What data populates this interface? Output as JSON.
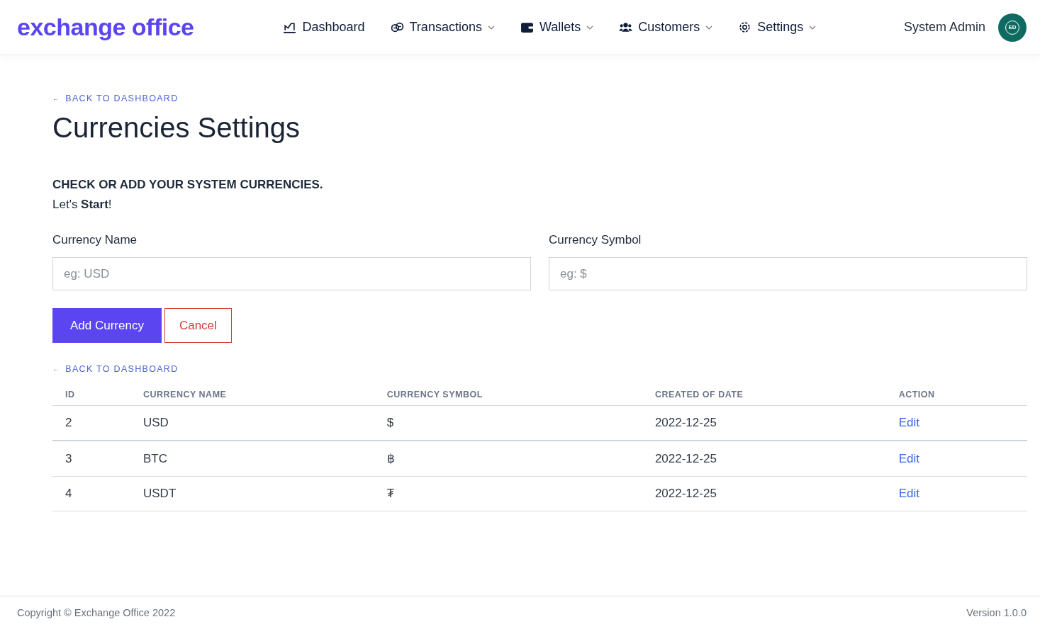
{
  "header": {
    "logo": "exchange office",
    "nav": [
      {
        "label": "Dashboard",
        "kind": "link"
      },
      {
        "label": "Transactions",
        "kind": "menu"
      },
      {
        "label": "Wallets",
        "kind": "menu"
      },
      {
        "label": "Customers",
        "kind": "menu"
      },
      {
        "label": "Settings",
        "kind": "menu"
      }
    ],
    "user": {
      "name": "System Admin",
      "initials": "ED"
    }
  },
  "page": {
    "back_link": {
      "arrow": "←",
      "label": "BACK TO DASHBOARD"
    },
    "title": "Currencies Settings",
    "subtitle": "CHECK OR ADD YOUR SYSTEM CURRENCIES.",
    "intro": "Let's **Start**!"
  },
  "form": {
    "fields": [
      {
        "label": "Currency Name",
        "placeholder": "eg: USD"
      },
      {
        "label": "Currency Symbol",
        "placeholder": "eg: $"
      }
    ],
    "buttons": [
      {
        "label": "Add Currency",
        "kind": "primary"
      },
      {
        "label": "Cancel",
        "kind": "outline"
      }
    ]
  },
  "table_back_link": {
    "arrow": "←",
    "label": "BACK TO DASHBOARD"
  },
  "table": {
    "columns": [
      "ID",
      "CURRENCY NAME",
      "CURRENCY SYMBOL",
      "CREATED OF DATE",
      "ACTION"
    ],
    "rows": [
      {
        "id": "2",
        "name": "USD",
        "symbol": "$",
        "created": "2022-12-25",
        "action": "Edit"
      },
      {
        "id": "3",
        "name": "BTC",
        "symbol": "฿",
        "created": "2022-12-25",
        "action": "Edit"
      },
      {
        "id": "4",
        "name": "USDT",
        "symbol": "₮",
        "created": "2022-12-25",
        "action": "Edit"
      }
    ]
  },
  "footer": {
    "copyright": "Copyright © Exchange Office 2022",
    "version": "Version 1.0.0"
  }
}
